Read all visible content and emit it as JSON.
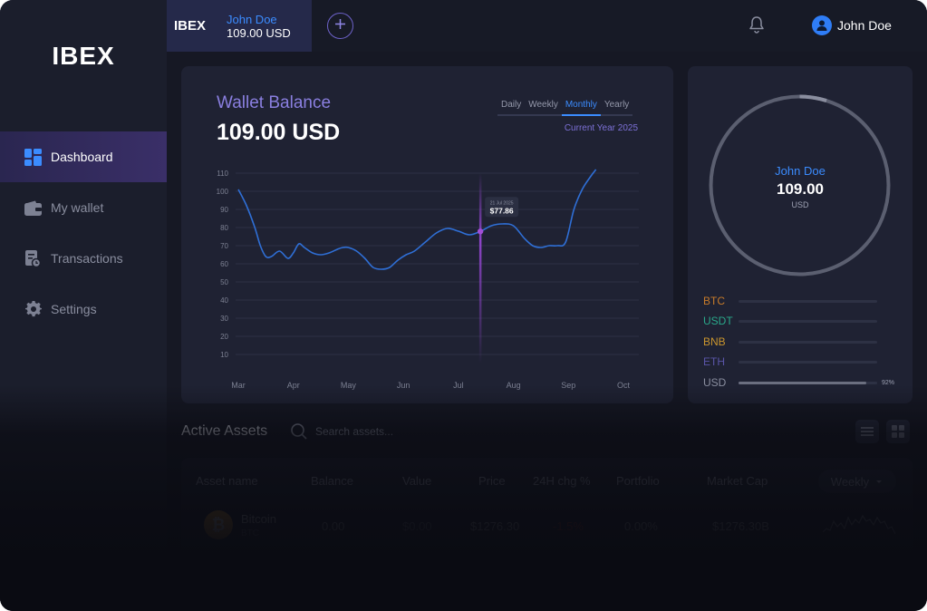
{
  "brand": {
    "logo": "IBEX"
  },
  "sidebar": {
    "items": [
      {
        "label": "Dashboard",
        "icon": "dashboard-icon",
        "active": true
      },
      {
        "label": "My wallet",
        "icon": "wallet-icon",
        "active": false
      },
      {
        "label": "Transactions",
        "icon": "transactions-icon",
        "active": false
      },
      {
        "label": "Settings",
        "icon": "gear-icon",
        "active": false
      }
    ]
  },
  "topbar": {
    "account_tab": {
      "exchange": "IBEX",
      "name": "John Doe",
      "balance": "109.00 USD"
    },
    "add_icon": "plus-circle-icon",
    "bell_icon": "bell-icon",
    "user": {
      "name": "John Doe",
      "avatar_icon": "user-icon"
    }
  },
  "wallet_balance": {
    "title": "Wallet Balance",
    "value": "109.00 USD",
    "periods": [
      "Daily",
      "Weekly",
      "Monthly",
      "Yearly"
    ],
    "active_period": "Monthly",
    "range_label": "Current Year 2025",
    "tooltip": {
      "date": "21 Jul 2025",
      "value": "$77.86"
    }
  },
  "chart_data": {
    "type": "line",
    "title": "Wallet Balance",
    "xlabel": "",
    "ylabel": "",
    "categories": [
      "Mar",
      "Apr",
      "May",
      "Jun",
      "Jul",
      "Aug",
      "Sep",
      "Oct"
    ],
    "yticks": [
      110,
      100,
      90,
      80,
      70,
      60,
      50,
      40,
      30,
      20,
      10
    ],
    "ylim": [
      0,
      110
    ],
    "grid": true,
    "series": [
      {
        "color": "#2f6fd6",
        "x": [
          0,
          0.15,
          0.3,
          0.4,
          0.5,
          0.6,
          0.75,
          0.9,
          1.0,
          1.1,
          1.2,
          1.35,
          1.5,
          1.65,
          1.8,
          1.9,
          2.0,
          2.15,
          2.3,
          2.45,
          2.6,
          2.75,
          2.9,
          3.05,
          3.2,
          3.4,
          3.6,
          3.8,
          4.0,
          4.2,
          4.4,
          4.6,
          4.8,
          5.0,
          5.2,
          5.35,
          5.5,
          5.65,
          5.8,
          5.95,
          6.1,
          6.25,
          6.4,
          6.5
        ],
        "values": [
          101,
          92,
          80,
          70,
          64,
          64,
          67,
          63,
          66,
          71,
          69,
          66,
          65,
          66,
          68,
          69,
          69,
          67,
          63,
          58,
          57,
          58,
          62,
          65,
          67,
          72,
          77,
          79.5,
          78,
          76,
          77.86,
          81,
          82,
          81,
          74,
          70,
          69,
          70,
          70,
          72,
          90,
          101,
          108,
          112
        ]
      }
    ],
    "highlight": {
      "x": 4.4,
      "value": 77.86,
      "label": "$77.86"
    }
  },
  "portfolio": {
    "name": "John Doe",
    "value": "109.00",
    "unit": "USD",
    "assets": [
      {
        "label": "BTC",
        "color": "#c77b2a",
        "fraction": 0,
        "pct": ""
      },
      {
        "label": "USDT",
        "color": "#2aa88a",
        "fraction": 0,
        "pct": ""
      },
      {
        "label": "BNB",
        "color": "#c9952e",
        "fraction": 0,
        "pct": ""
      },
      {
        "label": "ETH",
        "color": "#5a55a8",
        "fraction": 0,
        "pct": ""
      },
      {
        "label": "USD",
        "color": "#8a8e9f",
        "fraction": 0.92,
        "pct": "92%"
      }
    ]
  },
  "active_assets": {
    "title": "Active Assets",
    "search_placeholder": "Search assets...",
    "search_icon": "search-icon",
    "view_icons": [
      "list-view-icon",
      "grid-view-icon"
    ],
    "columns": [
      "Asset name",
      "Balance",
      "Value",
      "Price",
      "24H chg %",
      "Portfolio",
      "Market Cap"
    ],
    "filter": "Weekly",
    "rows": [
      {
        "name": "Bitcoin",
        "symbol": "BTC",
        "coin_icon": "bitcoin-icon",
        "balance": "0.00",
        "value": "$0.00",
        "price": "$1276.30",
        "change": "-1.5%",
        "portfolio": "0.00%",
        "market_cap": "$1276.30B",
        "sparkline_icon": "sparkline-icon"
      }
    ]
  },
  "colors": {
    "accent": "#3b8cff",
    "purple": "#8a7fe0",
    "background": "#161824",
    "sidebar": "#1b1e2c",
    "card": "#1f2233"
  }
}
